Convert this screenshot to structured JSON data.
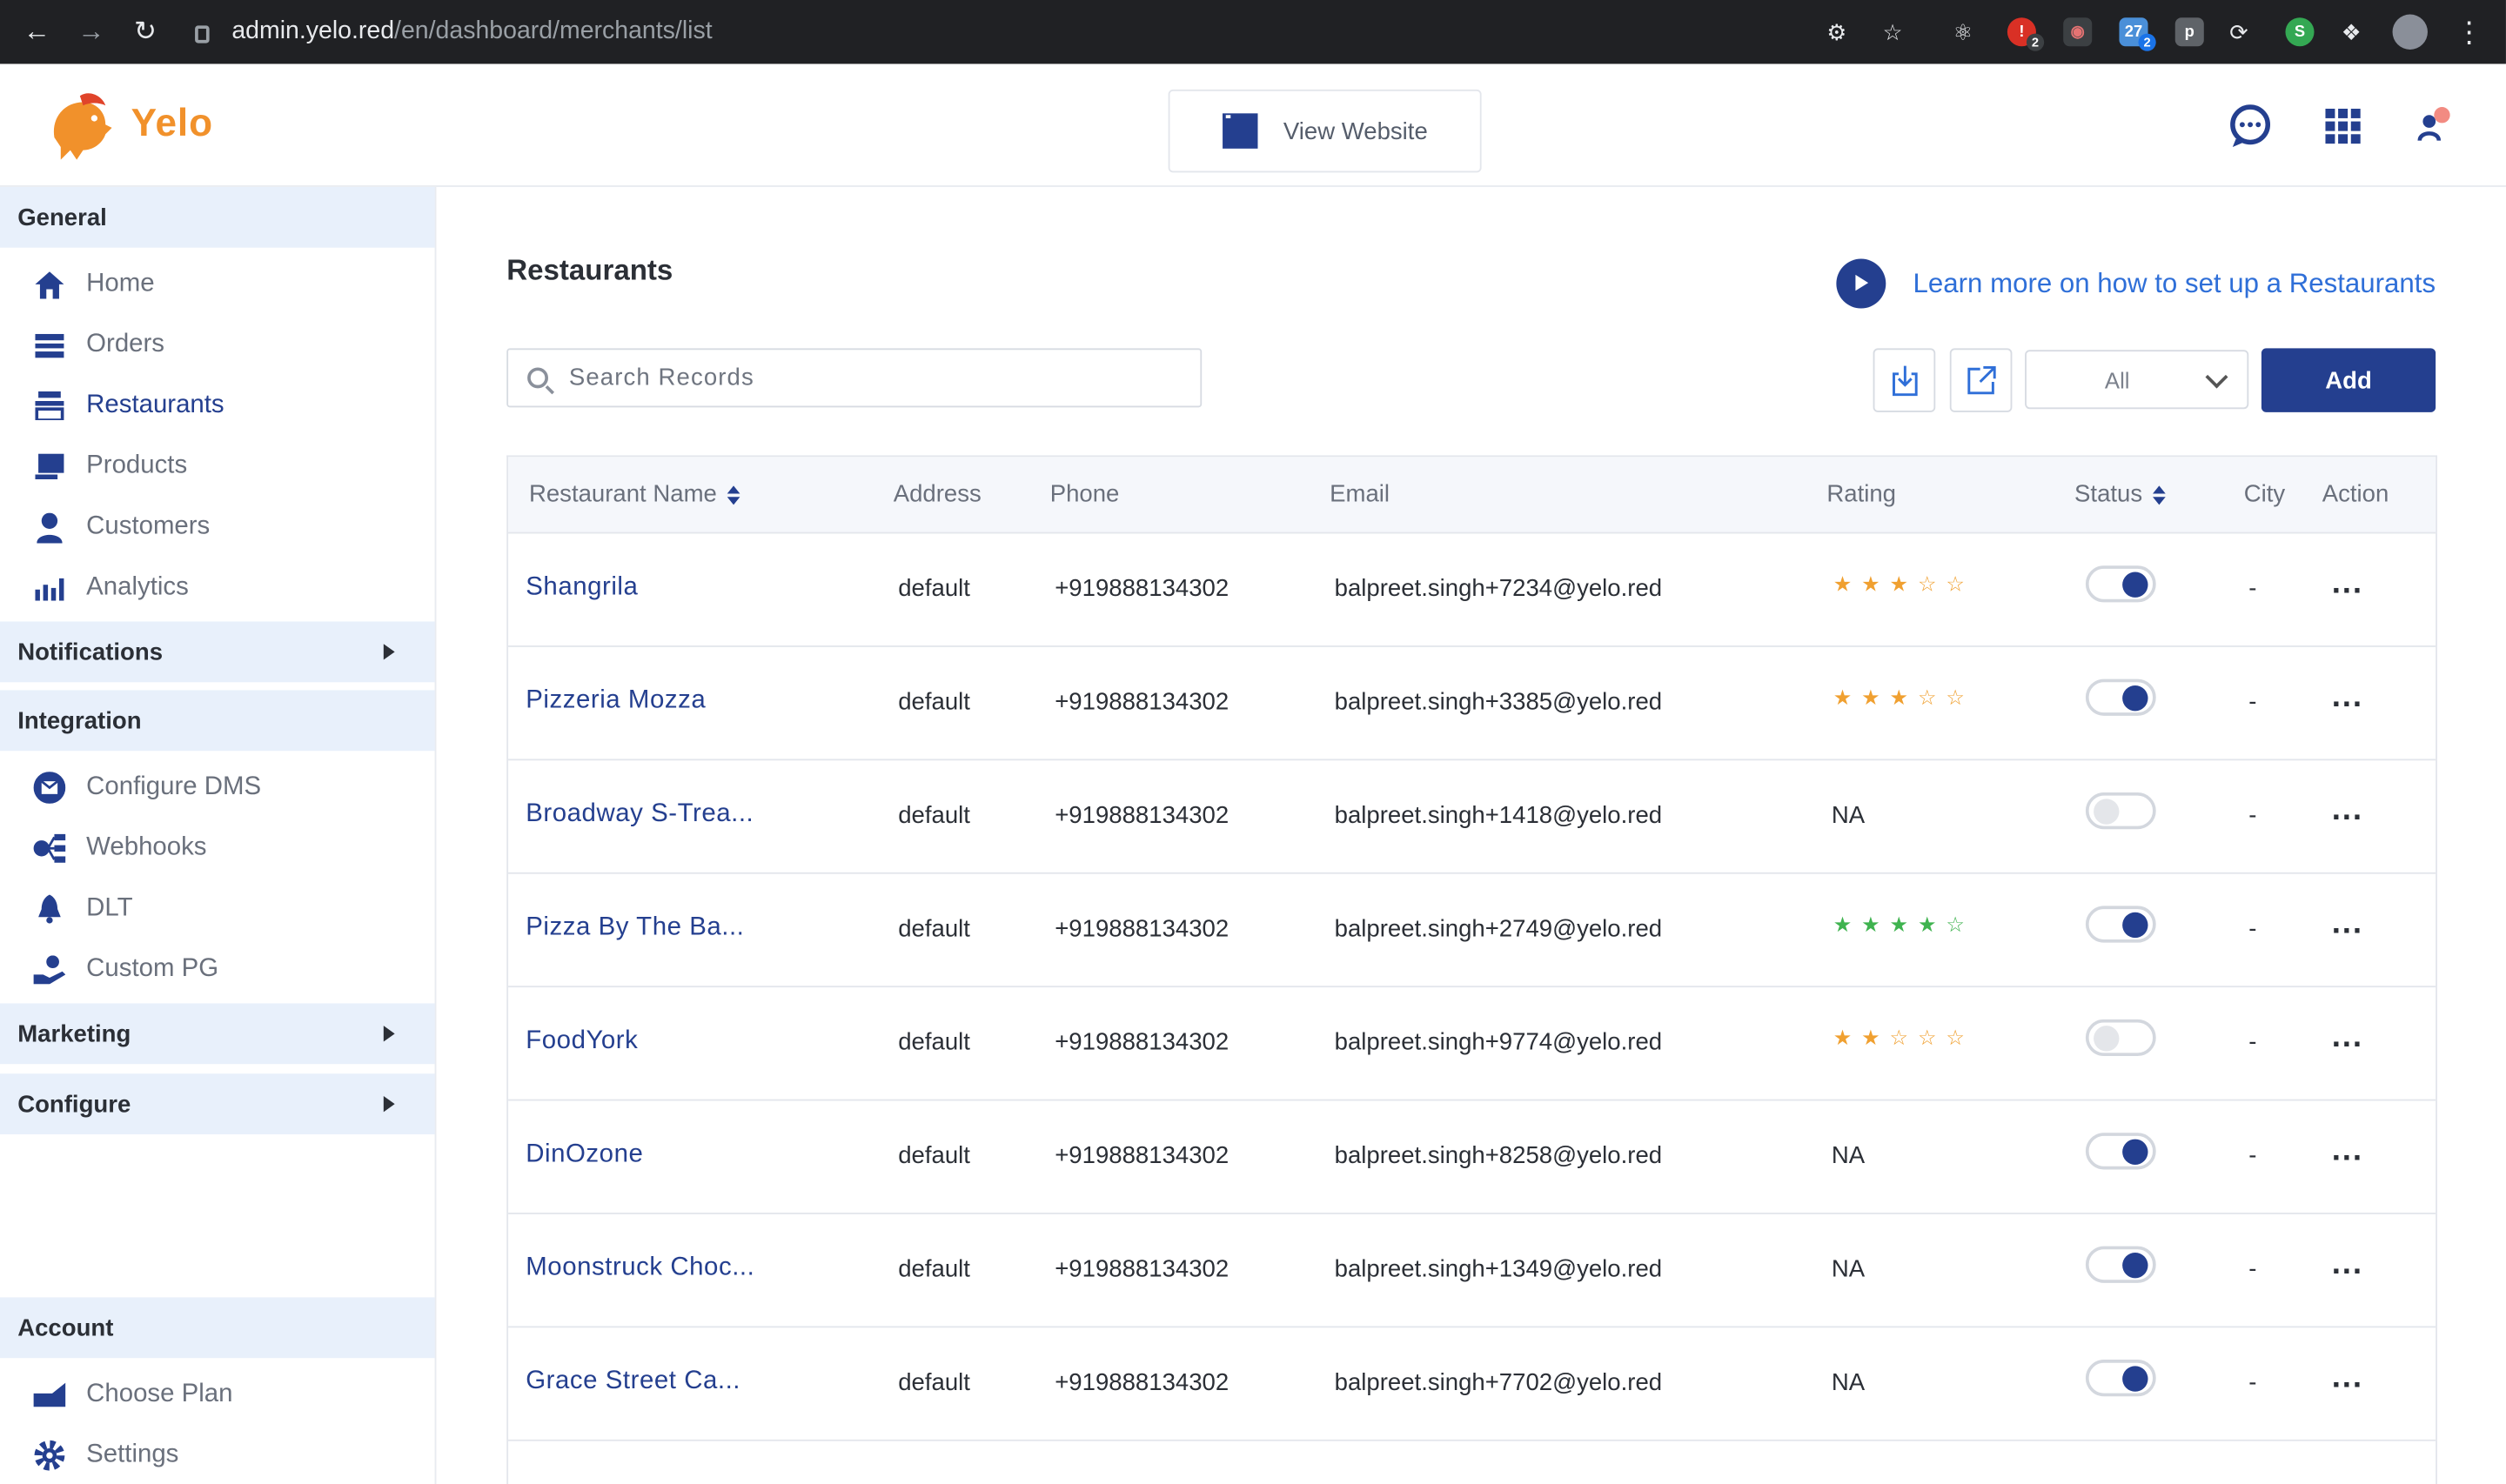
{
  "browser": {
    "url_host": "admin.yelo.red",
    "url_path": "/en/dashboard/merchants/list"
  },
  "header": {
    "logo_text": "Yelo",
    "view_website": "View Website"
  },
  "sidebar": {
    "general": "General",
    "items_general": [
      {
        "label": "Home",
        "icon": "home-icon"
      },
      {
        "label": "Orders",
        "icon": "orders-icon"
      },
      {
        "label": "Restaurants",
        "icon": "restaurant-icon"
      },
      {
        "label": "Products",
        "icon": "products-icon"
      },
      {
        "label": "Customers",
        "icon": "customers-icon"
      },
      {
        "label": "Analytics",
        "icon": "analytics-icon"
      }
    ],
    "notifications": "Notifications",
    "integration": "Integration",
    "items_integration": [
      {
        "label": "Configure DMS",
        "icon": "dms-icon"
      },
      {
        "label": "Webhooks",
        "icon": "webhooks-icon"
      },
      {
        "label": "DLT",
        "icon": "bell-icon"
      },
      {
        "label": "Custom PG",
        "icon": "payment-icon"
      }
    ],
    "marketing": "Marketing",
    "configure": "Configure",
    "account": "Account",
    "items_account": [
      {
        "label": "Choose Plan",
        "icon": "plan-icon"
      },
      {
        "label": "Settings",
        "icon": "gear-icon"
      }
    ],
    "active": "Restaurants"
  },
  "main": {
    "title": "Restaurants",
    "learn_more": "Learn more on how to set up a Restaurants",
    "search_placeholder": "Search Records",
    "filter_value": "All",
    "add_label": "Add"
  },
  "table": {
    "columns": [
      "Restaurant Name",
      "Address",
      "Phone",
      "Email",
      "Rating",
      "Status",
      "City",
      "Action"
    ],
    "rows": [
      {
        "name": "Shangrila",
        "address": "default",
        "phone": "+919888134302",
        "email": "balpreet.singh+7234@yelo.red",
        "rating": 3,
        "rating_text": "",
        "status": true,
        "city": "-"
      },
      {
        "name": "Pizzeria Mozza",
        "address": "default",
        "phone": "+919888134302",
        "email": "balpreet.singh+3385@yelo.red",
        "rating": 3,
        "rating_text": "",
        "status": true,
        "city": "-"
      },
      {
        "name": "Broadway S-Trea...",
        "address": "default",
        "phone": "+919888134302",
        "email": "balpreet.singh+1418@yelo.red",
        "rating": null,
        "rating_text": "NA",
        "status": false,
        "city": "-"
      },
      {
        "name": "Pizza By The Ba...",
        "address": "default",
        "phone": "+919888134302",
        "email": "balpreet.singh+2749@yelo.red",
        "rating": 4,
        "rating_text": "",
        "status": true,
        "city": "-"
      },
      {
        "name": "FoodYork",
        "address": "default",
        "phone": "+919888134302",
        "email": "balpreet.singh+9774@yelo.red",
        "rating": 2,
        "rating_text": "",
        "status": false,
        "city": "-"
      },
      {
        "name": "DinOzone",
        "address": "default",
        "phone": "+919888134302",
        "email": "balpreet.singh+8258@yelo.red",
        "rating": null,
        "rating_text": "NA",
        "status": true,
        "city": "-"
      },
      {
        "name": "Moonstruck Choc...",
        "address": "default",
        "phone": "+919888134302",
        "email": "balpreet.singh+1349@yelo.red",
        "rating": null,
        "rating_text": "NA",
        "status": true,
        "city": "-"
      },
      {
        "name": "Grace Street Ca...",
        "address": "default",
        "phone": "+919888134302",
        "email": "balpreet.singh+7702@yelo.red",
        "rating": null,
        "rating_text": "NA",
        "status": true,
        "city": "-"
      }
    ],
    "action_label": "..."
  },
  "colors": {
    "primary": "#243f8f",
    "link": "#2f6fd8",
    "star_orange": "#f0a030",
    "star_green": "#3fb34f",
    "sidebar_section_bg": "#e8f0fb"
  }
}
